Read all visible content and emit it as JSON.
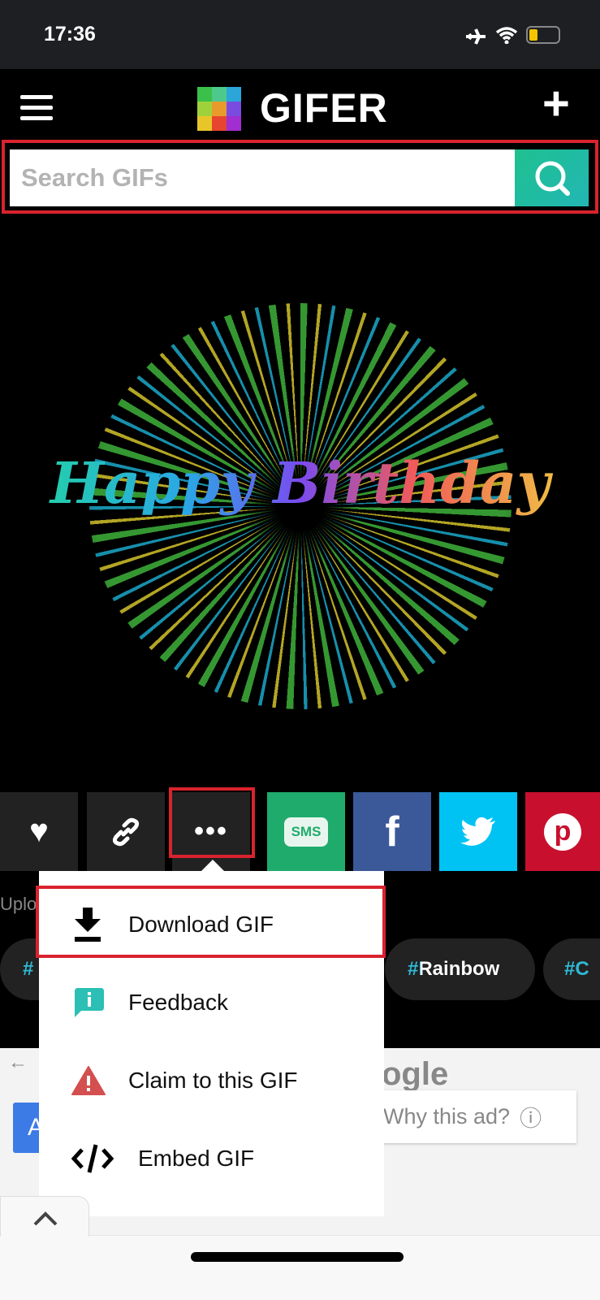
{
  "status": {
    "time": "17:36"
  },
  "header": {
    "brand": "GIFER",
    "menu_icon": "hamburger-icon",
    "add_icon": "plus-icon"
  },
  "search": {
    "placeholder": "Search GIFs",
    "button_icon": "search-icon"
  },
  "gif": {
    "text": "Happy Birthday"
  },
  "actions": [
    {
      "name": "like",
      "icon": "heart-icon",
      "color": "#222222"
    },
    {
      "name": "copy-link",
      "icon": "link-icon",
      "color": "#222222"
    },
    {
      "name": "more",
      "icon": "ellipsis-icon",
      "color": "#222222"
    },
    {
      "name": "sms",
      "label": "SMS",
      "color": "#1fab6c"
    },
    {
      "name": "facebook",
      "label": "f",
      "color": "#3b5998"
    },
    {
      "name": "twitter",
      "icon": "twitter-bird-icon",
      "color": "#00c3f3"
    },
    {
      "name": "pinterest",
      "icon": "pinterest-icon",
      "color": "#c8102e"
    }
  ],
  "menu": {
    "items": [
      {
        "label": "Download GIF",
        "icon": "download-icon"
      },
      {
        "label": "Feedback",
        "icon": "info-bubble-icon"
      },
      {
        "label": "Claim to this GIF",
        "icon": "warning-icon"
      },
      {
        "label": "Embed GIF",
        "icon": "code-icon"
      }
    ]
  },
  "uploaded_partial": "Uplo",
  "tags": [
    "#",
    "#Rainbow",
    "#C"
  ],
  "ad": {
    "back": "←",
    "logo_partial": "ogle",
    "why": "Why this ad?",
    "info": "ⓘ",
    "button_partial": "A"
  },
  "colors": {
    "accent": "#1fc08f",
    "highlight": "#d9232e"
  }
}
